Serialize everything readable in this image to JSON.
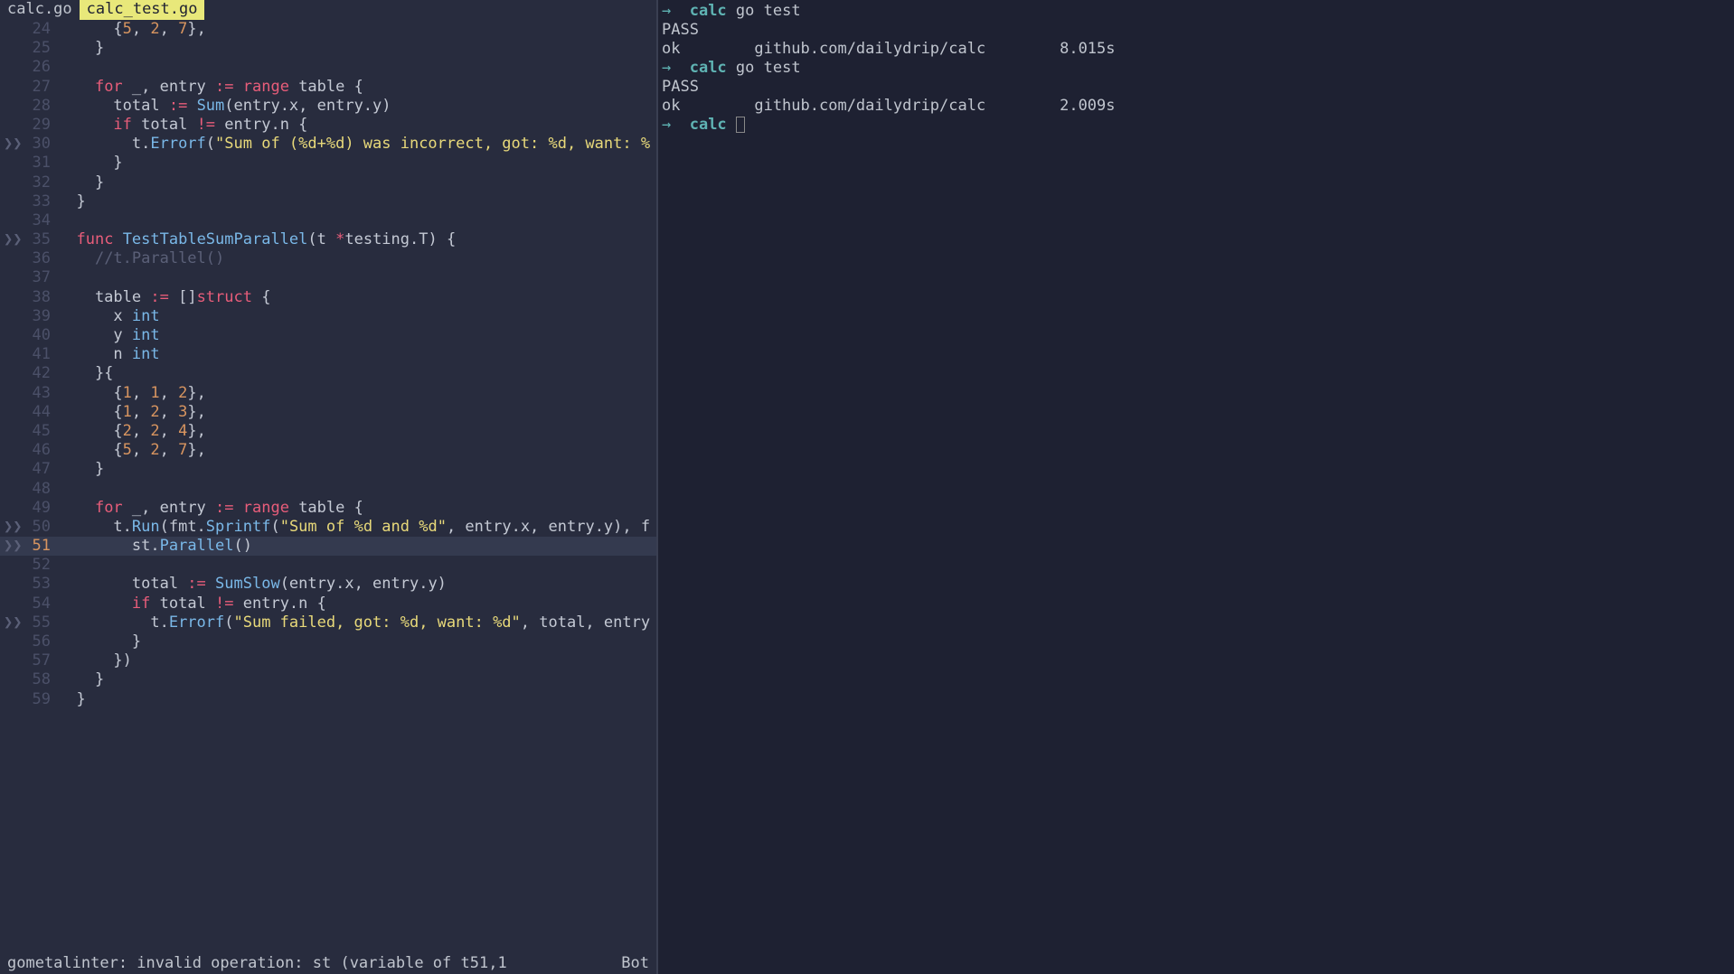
{
  "tabs": [
    {
      "label": "calc.go",
      "active": false
    },
    {
      "label": " calc_test.go ",
      "active": true
    }
  ],
  "code_lines": [
    {
      "mark": "",
      "num": "24",
      "tokens": [
        [
          "ident",
          "      {"
        ],
        [
          "num",
          "5"
        ],
        [
          "ident",
          ", "
        ],
        [
          "num",
          "2"
        ],
        [
          "ident",
          ", "
        ],
        [
          "num",
          "7"
        ],
        [
          "ident",
          "},"
        ]
      ]
    },
    {
      "mark": "",
      "num": "25",
      "tokens": [
        [
          "ident",
          "    }"
        ]
      ]
    },
    {
      "mark": "",
      "num": "26",
      "tokens": []
    },
    {
      "mark": "",
      "num": "27",
      "tokens": [
        [
          "ident",
          "    "
        ],
        [
          "kw",
          "for"
        ],
        [
          "ident",
          " _, entry "
        ],
        [
          "op",
          ":="
        ],
        [
          "ident",
          " "
        ],
        [
          "kw",
          "range"
        ],
        [
          "ident",
          " table {"
        ]
      ]
    },
    {
      "mark": "",
      "num": "28",
      "tokens": [
        [
          "ident",
          "      total "
        ],
        [
          "op",
          ":="
        ],
        [
          "ident",
          " "
        ],
        [
          "fn",
          "Sum"
        ],
        [
          "ident",
          "(entry.x, entry.y)"
        ]
      ]
    },
    {
      "mark": "",
      "num": "29",
      "tokens": [
        [
          "ident",
          "      "
        ],
        [
          "kw",
          "if"
        ],
        [
          "ident",
          " total "
        ],
        [
          "op",
          "!="
        ],
        [
          "ident",
          " entry.n {"
        ]
      ]
    },
    {
      "mark": "❯❯",
      "num": "30",
      "tokens": [
        [
          "ident",
          "        t."
        ],
        [
          "fn",
          "Errorf"
        ],
        [
          "ident",
          "("
        ],
        [
          "str",
          "\"Sum of (%d+%d) was incorrect, got: %d, want: %"
        ]
      ]
    },
    {
      "mark": "",
      "num": "31",
      "tokens": [
        [
          "ident",
          "      }"
        ]
      ]
    },
    {
      "mark": "",
      "num": "32",
      "tokens": [
        [
          "ident",
          "    }"
        ]
      ]
    },
    {
      "mark": "",
      "num": "33",
      "tokens": [
        [
          "ident",
          "  }"
        ]
      ]
    },
    {
      "mark": "",
      "num": "34",
      "tokens": []
    },
    {
      "mark": "❯❯",
      "num": "35",
      "tokens": [
        [
          "ident",
          "  "
        ],
        [
          "kw",
          "func"
        ],
        [
          "ident",
          " "
        ],
        [
          "fn",
          "TestTableSumParallel"
        ],
        [
          "ident",
          "(t "
        ],
        [
          "op",
          "*"
        ],
        [
          "ident",
          "testing.T) {"
        ]
      ]
    },
    {
      "mark": "",
      "num": "36",
      "tokens": [
        [
          "ident",
          "    "
        ],
        [
          "cmt",
          "//t.Parallel()"
        ]
      ]
    },
    {
      "mark": "",
      "num": "37",
      "tokens": []
    },
    {
      "mark": "",
      "num": "38",
      "tokens": [
        [
          "ident",
          "    table "
        ],
        [
          "op",
          ":="
        ],
        [
          "ident",
          " []"
        ],
        [
          "struct",
          "struct"
        ],
        [
          "ident",
          " {"
        ]
      ]
    },
    {
      "mark": "",
      "num": "39",
      "tokens": [
        [
          "ident",
          "      x "
        ],
        [
          "type",
          "int"
        ]
      ]
    },
    {
      "mark": "",
      "num": "40",
      "tokens": [
        [
          "ident",
          "      y "
        ],
        [
          "type",
          "int"
        ]
      ]
    },
    {
      "mark": "",
      "num": "41",
      "tokens": [
        [
          "ident",
          "      n "
        ],
        [
          "type",
          "int"
        ]
      ]
    },
    {
      "mark": "",
      "num": "42",
      "tokens": [
        [
          "ident",
          "    }{"
        ]
      ]
    },
    {
      "mark": "",
      "num": "43",
      "tokens": [
        [
          "ident",
          "      {"
        ],
        [
          "num",
          "1"
        ],
        [
          "ident",
          ", "
        ],
        [
          "num",
          "1"
        ],
        [
          "ident",
          ", "
        ],
        [
          "num",
          "2"
        ],
        [
          "ident",
          "},"
        ]
      ]
    },
    {
      "mark": "",
      "num": "44",
      "tokens": [
        [
          "ident",
          "      {"
        ],
        [
          "num",
          "1"
        ],
        [
          "ident",
          ", "
        ],
        [
          "num",
          "2"
        ],
        [
          "ident",
          ", "
        ],
        [
          "num",
          "3"
        ],
        [
          "ident",
          "},"
        ]
      ]
    },
    {
      "mark": "",
      "num": "45",
      "tokens": [
        [
          "ident",
          "      {"
        ],
        [
          "num",
          "2"
        ],
        [
          "ident",
          ", "
        ],
        [
          "num",
          "2"
        ],
        [
          "ident",
          ", "
        ],
        [
          "num",
          "4"
        ],
        [
          "ident",
          "},"
        ]
      ]
    },
    {
      "mark": "",
      "num": "46",
      "tokens": [
        [
          "ident",
          "      {"
        ],
        [
          "num",
          "5"
        ],
        [
          "ident",
          ", "
        ],
        [
          "num",
          "2"
        ],
        [
          "ident",
          ", "
        ],
        [
          "num",
          "7"
        ],
        [
          "ident",
          "},"
        ]
      ]
    },
    {
      "mark": "",
      "num": "47",
      "tokens": [
        [
          "ident",
          "    }"
        ]
      ]
    },
    {
      "mark": "",
      "num": "48",
      "tokens": []
    },
    {
      "mark": "",
      "num": "49",
      "tokens": [
        [
          "ident",
          "    "
        ],
        [
          "kw",
          "for"
        ],
        [
          "ident",
          " _, entry "
        ],
        [
          "op",
          ":="
        ],
        [
          "ident",
          " "
        ],
        [
          "kw",
          "range"
        ],
        [
          "ident",
          " table {"
        ]
      ]
    },
    {
      "mark": "❯❯",
      "num": "50",
      "tokens": [
        [
          "ident",
          "      t."
        ],
        [
          "fn",
          "Run"
        ],
        [
          "ident",
          "(fmt."
        ],
        [
          "fn",
          "Sprintf"
        ],
        [
          "ident",
          "("
        ],
        [
          "str",
          "\"Sum of %d and %d\""
        ],
        [
          "ident",
          ", entry.x, entry.y), f"
        ]
      ]
    },
    {
      "mark": "❯❯",
      "num": "51",
      "current": true,
      "tokens": [
        [
          "ident",
          "        st."
        ],
        [
          "fn",
          "Parallel"
        ],
        [
          "ident",
          "()"
        ]
      ]
    },
    {
      "mark": "",
      "num": "52",
      "tokens": []
    },
    {
      "mark": "",
      "num": "53",
      "tokens": [
        [
          "ident",
          "        total "
        ],
        [
          "op",
          ":="
        ],
        [
          "ident",
          " "
        ],
        [
          "fn",
          "SumSlow"
        ],
        [
          "ident",
          "(entry.x, entry.y)"
        ]
      ]
    },
    {
      "mark": "",
      "num": "54",
      "tokens": [
        [
          "ident",
          "        "
        ],
        [
          "kw",
          "if"
        ],
        [
          "ident",
          " total "
        ],
        [
          "op",
          "!="
        ],
        [
          "ident",
          " entry.n {"
        ]
      ]
    },
    {
      "mark": "❯❯",
      "num": "55",
      "tokens": [
        [
          "ident",
          "          t."
        ],
        [
          "fn",
          "Errorf"
        ],
        [
          "ident",
          "("
        ],
        [
          "str",
          "\"Sum failed, got: %d, want: %d\""
        ],
        [
          "ident",
          ", total, entry"
        ]
      ]
    },
    {
      "mark": "",
      "num": "56",
      "tokens": [
        [
          "ident",
          "        }"
        ]
      ]
    },
    {
      "mark": "",
      "num": "57",
      "tokens": [
        [
          "ident",
          "      })"
        ]
      ]
    },
    {
      "mark": "",
      "num": "58",
      "tokens": [
        [
          "ident",
          "    }"
        ]
      ]
    },
    {
      "mark": "",
      "num": "59",
      "tokens": [
        [
          "ident",
          "  }"
        ]
      ]
    }
  ],
  "statusbar": {
    "left": "gometalinter: invalid operation: st (variable of t51,1",
    "right": "Bot"
  },
  "terminal_lines": [
    {
      "type": "prompt",
      "arrow": "→",
      "prompt": "calc",
      "cmd": " go test"
    },
    {
      "type": "out",
      "text": "PASS"
    },
    {
      "type": "out",
      "text": "ok        github.com/dailydrip/calc        8.015s"
    },
    {
      "type": "prompt",
      "arrow": "→",
      "prompt": "calc",
      "cmd": " go test"
    },
    {
      "type": "out",
      "text": "PASS"
    },
    {
      "type": "out",
      "text": "ok        github.com/dailydrip/calc        2.009s"
    },
    {
      "type": "prompt",
      "arrow": "→",
      "prompt": "calc",
      "cmd": "",
      "cursor": true
    }
  ]
}
